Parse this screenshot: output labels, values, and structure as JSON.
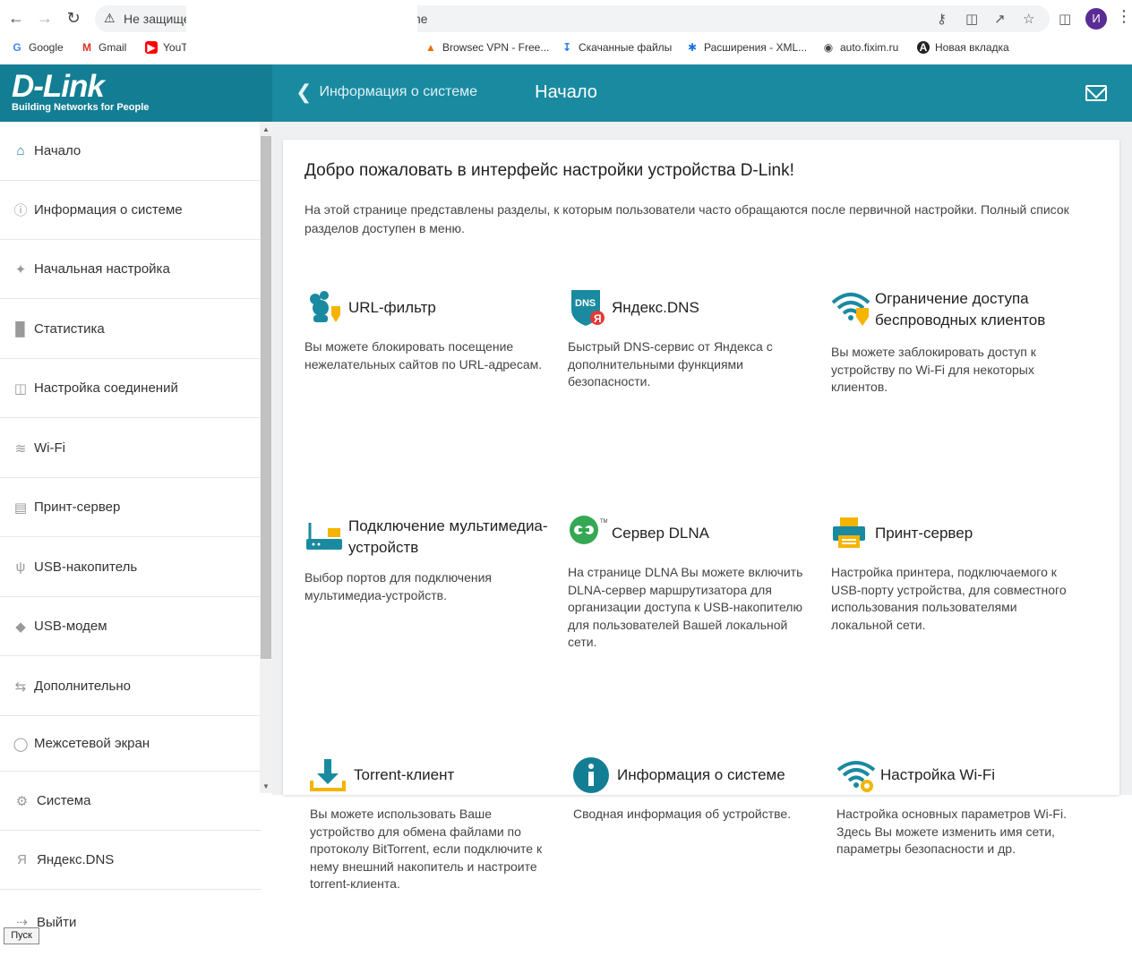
{
  "browser": {
    "security_text": "Не защище",
    "url_fragment": "ne",
    "profile_initial": "И",
    "bookmarks": [
      {
        "label": "Google"
      },
      {
        "label": "Gmail"
      },
      {
        "label": "YouT"
      },
      {
        "label": "Browsec VPN - Free..."
      },
      {
        "label": "Скачанные файлы"
      },
      {
        "label": "Расширения - XML..."
      },
      {
        "label": "auto.fixim.ru"
      },
      {
        "label": "Новая вкладка"
      }
    ]
  },
  "header": {
    "logo": "D-Link",
    "logo_tagline": "Building Networks for People",
    "back_label": "Информация о системе",
    "title": "Начало",
    "brand_color": "#1a8aa0"
  },
  "sidebar": {
    "items": [
      {
        "label": "Начало",
        "icon": "home-icon",
        "active": true
      },
      {
        "label": "Информация о системе",
        "icon": "info-icon"
      },
      {
        "label": "Начальная настройка",
        "icon": "wizard-icon"
      },
      {
        "label": "Статистика",
        "icon": "chart-icon"
      },
      {
        "label": "Настройка соединений",
        "icon": "connections-icon"
      },
      {
        "label": "Wi-Fi",
        "icon": "wifi-icon"
      },
      {
        "label": "Принт-сервер",
        "icon": "printer-icon"
      },
      {
        "label": "USB-накопитель",
        "icon": "usb-icon"
      },
      {
        "label": "USB-модем",
        "icon": "modem-icon"
      },
      {
        "label": "Дополнительно",
        "icon": "arrows-icon"
      },
      {
        "label": "Межсетевой экран",
        "icon": "shield-icon"
      },
      {
        "label": "Система",
        "icon": "gear-icon"
      },
      {
        "label": "Яндекс.DNS",
        "icon": "yandex-icon"
      },
      {
        "label": "Выйти",
        "icon": "logout-icon"
      }
    ]
  },
  "taskbar": {
    "start_label": "Пуск"
  },
  "main": {
    "welcome": "Добро пожаловать в интерфейс настройки устройства D-Link!",
    "intro": "На этой странице представлены разделы, к которым пользователи часто обращаются после первичной настройки. Полный список разделов доступен в меню.",
    "tiles": [
      {
        "title": "URL-фильтр",
        "desc": "Вы можете блокировать посещение нежелательных сайтов по URL-адресам.",
        "icon": "url-filter-icon"
      },
      {
        "title": "Яндекс.DNS",
        "desc": "Быстрый DNS-сервис от Яндекса с дополнительными функциями безопасности.",
        "icon": "yandex-dns-icon"
      },
      {
        "title": "Ограничение доступа беспроводных клиентов",
        "desc": "Вы можете заблокировать доступ к устройству по Wi-Fi для некоторых клиентов.",
        "icon": "wifi-restrict-icon"
      },
      {
        "title": "Подключение мультимедиа-устройств",
        "desc": "Выбор портов для подключения мультимедиа-устройств.",
        "icon": "multimedia-icon"
      },
      {
        "title": "Сервер DLNA",
        "desc": "На странице DLNA Вы можете включить DLNA-сервер маршрутизатора для организации доступа к USB-накопителю для пользователей Вашей локальной сети.",
        "icon": "dlna-icon"
      },
      {
        "title": "Принт-сервер",
        "desc": "Настройка принтера, подключаемого к USB-порту устройства, для совместного использования пользователями локальной сети.",
        "icon": "print-server-icon"
      },
      {
        "title": "Torrent-клиент",
        "desc": "Вы можете использовать Ваше устройство для обмена файлами по протоколу BitTorrent, если подключите к нему внешний накопитель и настроите torrent-клиента.",
        "icon": "torrent-icon"
      },
      {
        "title": "Информация о системе",
        "desc": "Сводная информация об устройстве.",
        "icon": "system-info-icon"
      },
      {
        "title": "Настройка Wi-Fi",
        "desc": "Настройка основных параметров Wi-Fi. Здесь Вы можете изменить имя сети, параметры безопасности и др.",
        "icon": "wifi-settings-icon"
      }
    ]
  }
}
